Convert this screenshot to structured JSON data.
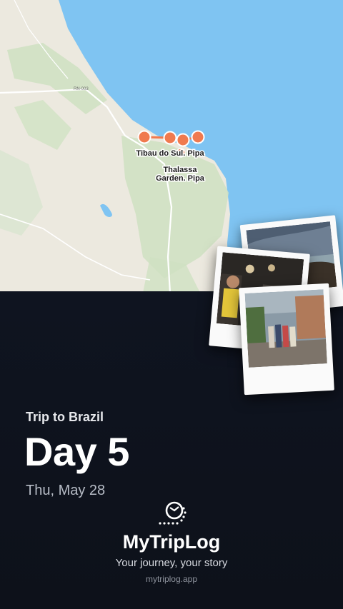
{
  "map": {
    "labels": {
      "stop1": "Tibau do Sul. Pipa",
      "stop2_line1": "Thalassa",
      "stop2_line2": "Garden. Pipa",
      "road": "RN-003"
    },
    "colors": {
      "sea": "#7fc4f2",
      "land": "#ece9df",
      "green": "#cfe1c2",
      "marker": "#f07a4f"
    }
  },
  "story": {
    "trip_title": "Trip to Brazil",
    "day_title": "Day 5",
    "date": "Thu, May 28"
  },
  "brand": {
    "name": "MyTripLog",
    "tagline": "Your journey, your story",
    "url": "mytriplog.app"
  }
}
